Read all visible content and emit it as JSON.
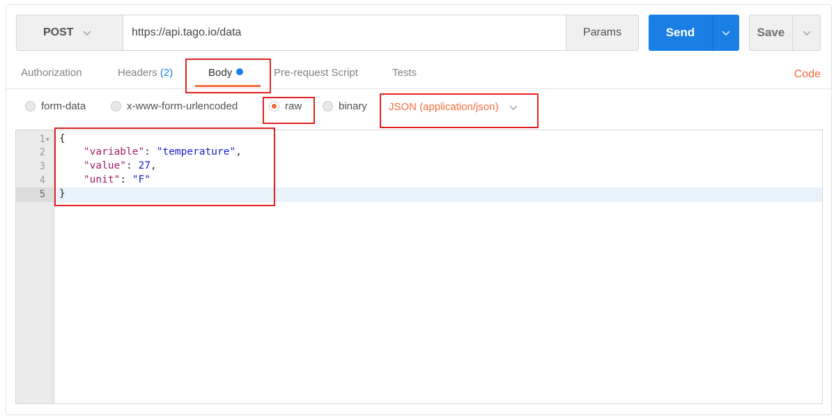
{
  "request": {
    "method": "POST",
    "url": "https://api.tago.io/data",
    "params_label": "Params",
    "send_label": "Send",
    "save_label": "Save"
  },
  "tabs": [
    {
      "label": "Authorization"
    },
    {
      "label": "Headers",
      "count": "(2)"
    },
    {
      "label": "Body",
      "active": true
    },
    {
      "label": "Pre-request Script"
    },
    {
      "label": "Tests"
    }
  ],
  "code_link": "Code",
  "body_types": [
    {
      "label": "form-data",
      "selected": false
    },
    {
      "label": "x-www-form-urlencoded",
      "selected": false
    },
    {
      "label": "raw",
      "selected": true
    },
    {
      "label": "binary",
      "selected": false
    }
  ],
  "content_type": "JSON (application/json)",
  "editor": {
    "line_numbers": [
      "1",
      "2",
      "3",
      "4",
      "5"
    ],
    "lines": [
      {
        "open": "{"
      },
      {
        "key": "\"variable\"",
        "sep": ": ",
        "value": "\"temperature\"",
        "end": ","
      },
      {
        "key": "\"value\"",
        "sep": ": ",
        "value": "27",
        "end": ","
      },
      {
        "key": "\"unit\"",
        "sep": ": ",
        "value": "\"F\"",
        "end": ""
      },
      {
        "close": "}"
      }
    ]
  },
  "colors": {
    "accent": "#f26b3a",
    "primary": "#1a7fe5",
    "annotation": "#e0201c"
  }
}
